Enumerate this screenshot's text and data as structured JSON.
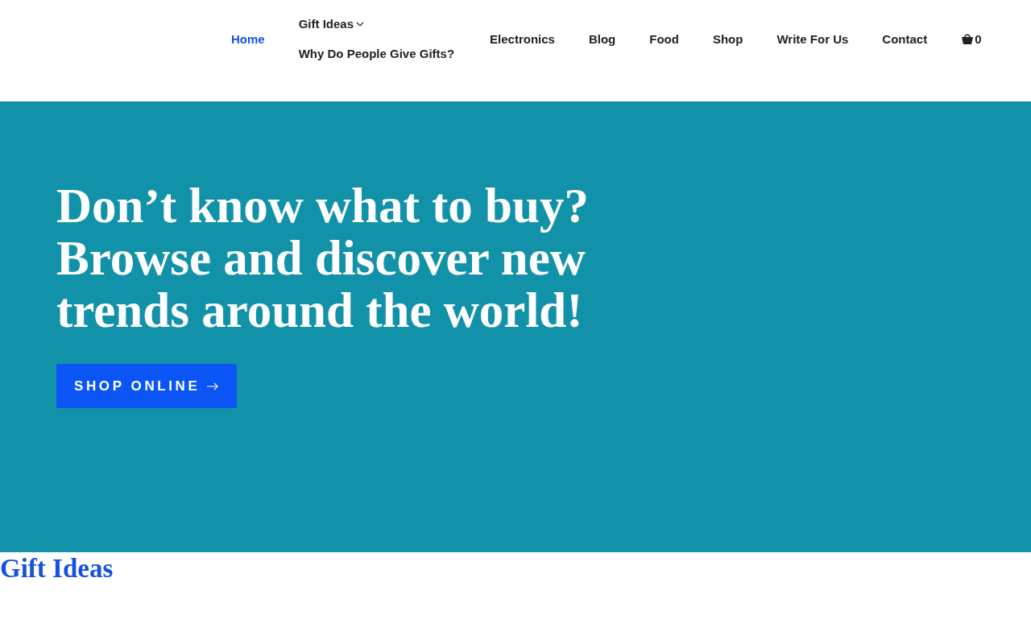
{
  "nav": {
    "items": [
      {
        "label": "Home",
        "selected": true
      },
      {
        "label": "Gift Ideas",
        "selected": false,
        "expanded": true,
        "children": [
          {
            "label": "Why Do People Give Gifts?",
            "selected": false
          }
        ]
      },
      {
        "label": "Electronics",
        "selected": false
      },
      {
        "label": "Blog",
        "selected": false
      },
      {
        "label": "Food",
        "selected": false
      },
      {
        "label": "Shop",
        "selected": false
      },
      {
        "label": "Write For Us",
        "selected": false
      },
      {
        "label": "Contact",
        "selected": false
      }
    ],
    "cart_count": "0"
  },
  "hero": {
    "heading": "Don’t know what to buy? Browse and discover new trends around the world!",
    "button": "SHOP ONLINE"
  },
  "section": {
    "heading": "Gift Ideas"
  }
}
